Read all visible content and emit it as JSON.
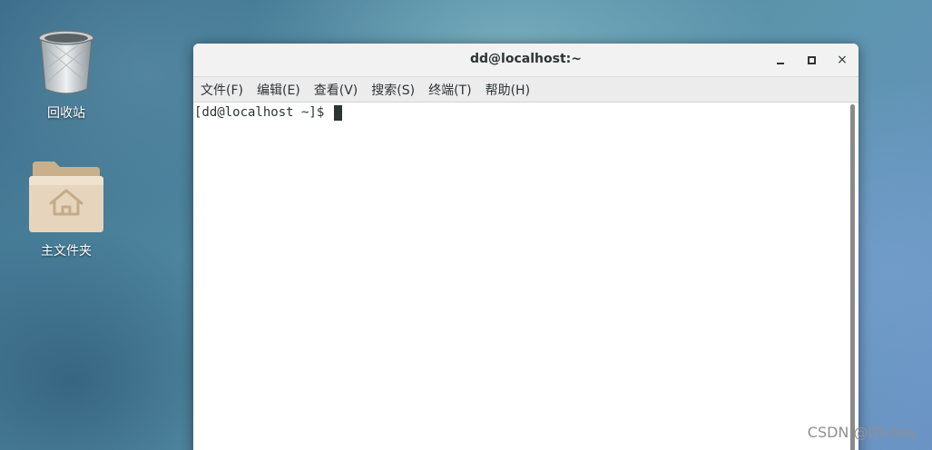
{
  "desktop": {
    "icons": [
      {
        "label": "回收站",
        "icon": "trash-icon"
      },
      {
        "label": "主文件夹",
        "icon": "home-folder-icon"
      }
    ]
  },
  "terminal": {
    "title": "dd@localhost:~",
    "controls": {
      "minimize": "minimize-icon",
      "maximize": "maximize-icon",
      "close": "×"
    },
    "menu": [
      {
        "label": "文件(F)"
      },
      {
        "label": "编辑(E)"
      },
      {
        "label": "查看(V)"
      },
      {
        "label": "搜索(S)"
      },
      {
        "label": "终端(T)"
      },
      {
        "label": "帮助(H)"
      }
    ],
    "prompt": "[dd@localhost ~]$ "
  },
  "watermark": "CSDN @DY-boy",
  "colors": {
    "window_bg": "#ffffff",
    "titlebar_bg": "#f2f2f2",
    "menubar_bg": "#ececec",
    "text": "#2e3436"
  }
}
